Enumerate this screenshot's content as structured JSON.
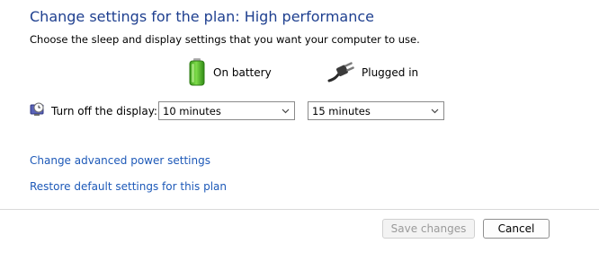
{
  "header": {
    "title": "Change settings for the plan: High performance",
    "subtitle": "Choose the sleep and display settings that you want your computer to use."
  },
  "columns": {
    "battery": {
      "label": "On battery",
      "icon": "battery-icon"
    },
    "plugged": {
      "label": "Plugged in",
      "icon": "plug-icon"
    }
  },
  "settings": {
    "display": {
      "icon": "display-timer-icon",
      "label": "Turn off the display:",
      "on_battery": "10 minutes",
      "plugged_in": "15 minutes"
    }
  },
  "links": {
    "advanced": "Change advanced power settings",
    "restore": "Restore default settings for this plan"
  },
  "buttons": {
    "save": "Save changes",
    "cancel": "Cancel"
  },
  "colors": {
    "title": "#1e3f8f",
    "link": "#1d59b8",
    "battery_green": "#49b829"
  }
}
